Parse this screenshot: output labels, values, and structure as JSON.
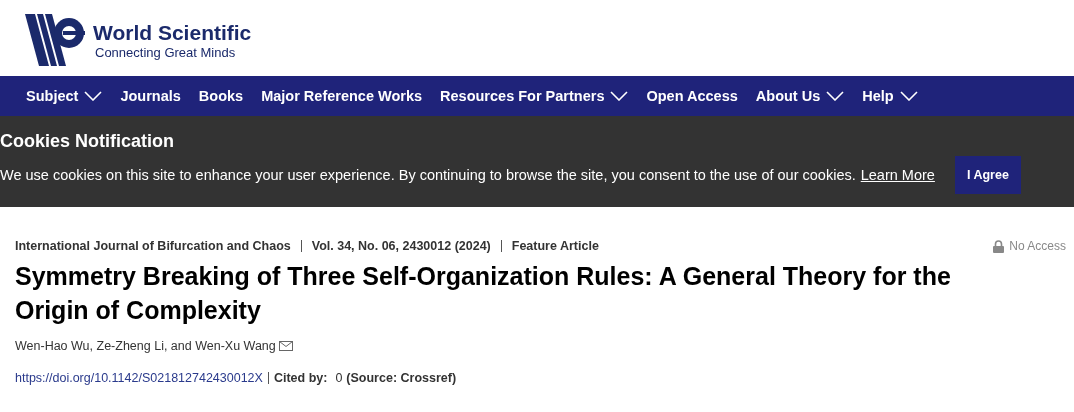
{
  "logo": {
    "name": "World Scientific",
    "tagline": "Connecting Great Minds"
  },
  "nav": [
    {
      "label": "Subject",
      "has_menu": true
    },
    {
      "label": "Journals",
      "has_menu": false
    },
    {
      "label": "Books",
      "has_menu": false
    },
    {
      "label": "Major Reference Works",
      "has_menu": false
    },
    {
      "label": "Resources For Partners",
      "has_menu": true
    },
    {
      "label": "Open Access",
      "has_menu": false
    },
    {
      "label": "About Us",
      "has_menu": true
    },
    {
      "label": "Help",
      "has_menu": true
    }
  ],
  "cookies": {
    "title": "Cookies Notification",
    "text": "We use cookies on this site to enhance your user experience. By continuing to browse the site, you consent to the use of our cookies.",
    "link": "Learn More",
    "button": "I Agree"
  },
  "article": {
    "journal": "International Journal of Bifurcation and Chaos",
    "volume": "Vol. 34, No. 06, 2430012 (2024)",
    "type": "Feature Article",
    "access": "No Access",
    "title": "Symmetry Breaking of Three Self-Organization Rules: A General Theory for the Origin of Complexity",
    "authors": "Wen-Hao Wu, Ze-Zheng Li, and Wen-Xu Wang",
    "doi": "https://doi.org/10.1142/S021812742430012X",
    "cited_label": "Cited by:",
    "cited_count": "0",
    "cited_source": "(Source: Crossref)"
  }
}
